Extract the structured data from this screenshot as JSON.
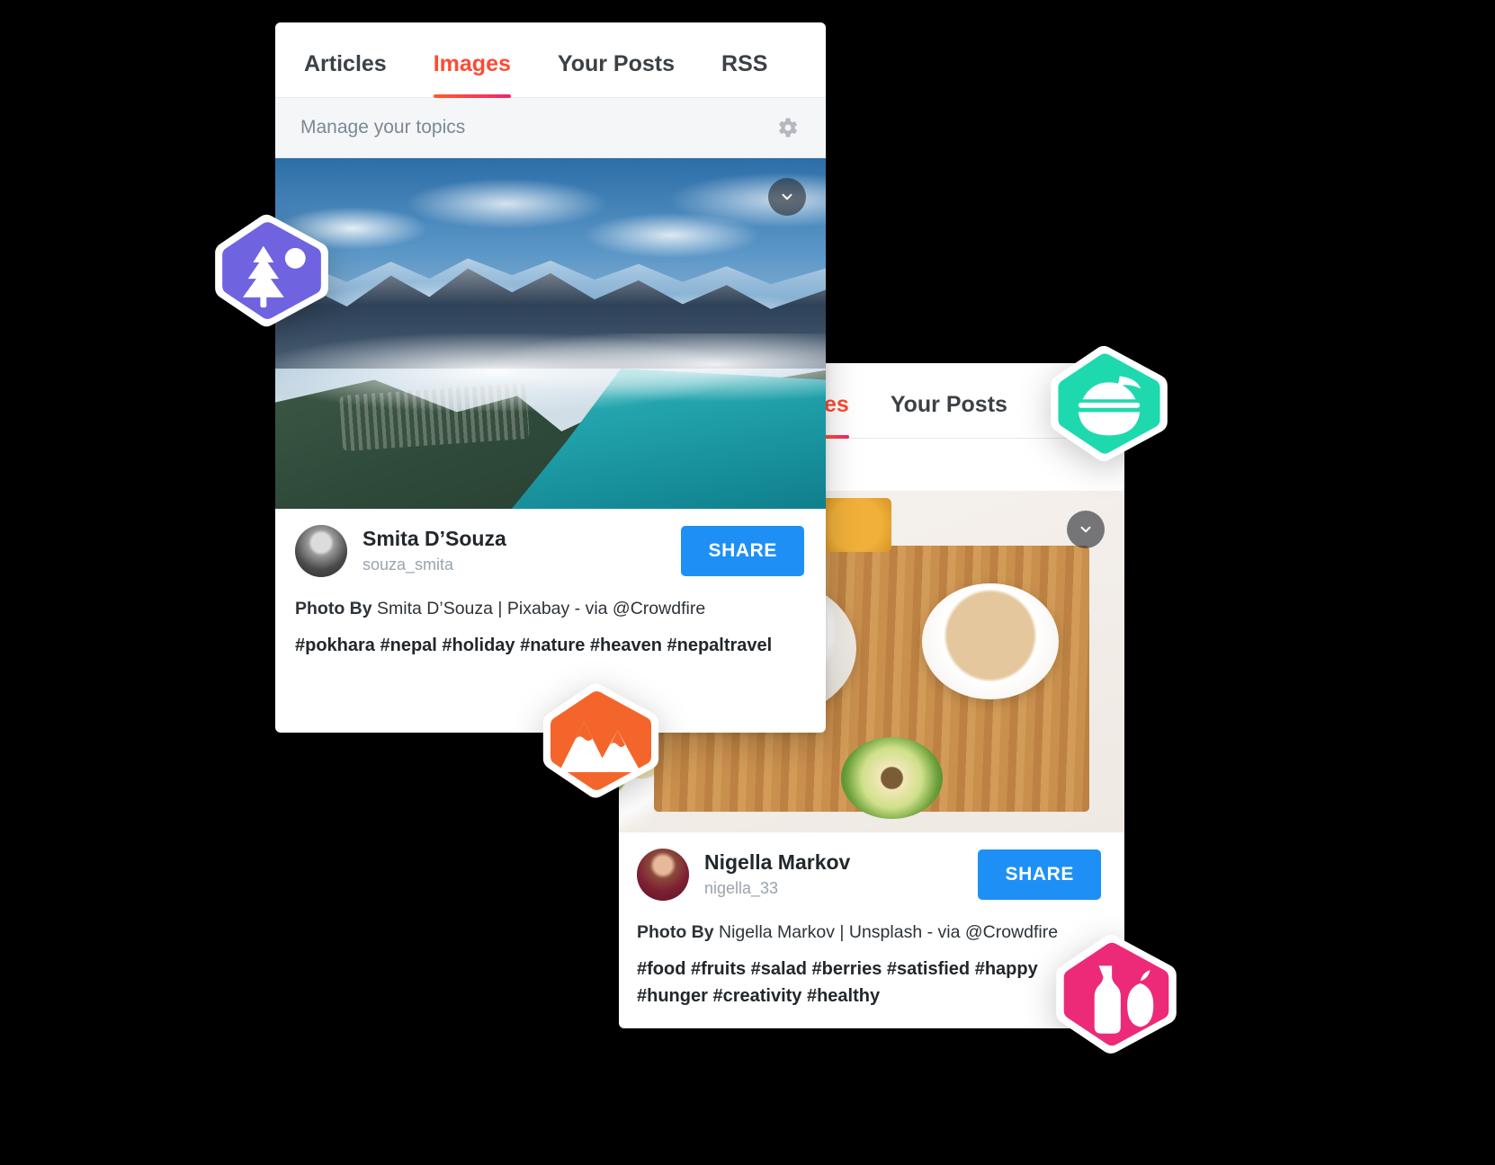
{
  "front_panel": {
    "tabs": [
      {
        "label": "Articles",
        "active": false
      },
      {
        "label": "Images",
        "active": true
      },
      {
        "label": "Your Posts",
        "active": false
      },
      {
        "label": "RSS",
        "active": false
      }
    ],
    "topic_bar": {
      "label": "Manage your topics",
      "gear_icon": "gear-icon"
    },
    "card": {
      "photo_alt": "mountain-lake-landscape",
      "chevron_icon": "chevron-down-icon",
      "user_name": "Smita D’Souza",
      "user_handle": "souza_smita",
      "share_label": "SHARE",
      "credit_prefix": "Photo By",
      "credit_text": "Smita D’Souza | Pixabay - via @Crowdfire",
      "hashtags": "#pokhara #nepal #holiday #nature #heaven #nepaltravel"
    }
  },
  "back_panel": {
    "tabs": [
      {
        "label": "es",
        "active": true
      },
      {
        "label": "Your Posts",
        "active": false
      }
    ],
    "card": {
      "photo_alt": "breakfast-bowl-flatlay",
      "chevron_icon": "chevron-down-icon",
      "user_name": "Nigella Markov",
      "user_handle": "nigella_33",
      "share_label": "SHARE",
      "credit_prefix": "Photo By",
      "credit_text": "Nigella Markov | Unsplash - via @Crowdfire",
      "hashtags": "#food #fruits #salad #berries #satisfied #happy #hunger #creativity #healthy"
    }
  },
  "badges": [
    {
      "name": "nature-badge",
      "icon": "pine-tree-icon",
      "color": "#6f63e0"
    },
    {
      "name": "food-badge",
      "icon": "salad-bowl-icon",
      "color": "#1fd9ae"
    },
    {
      "name": "travel-badge",
      "icon": "mountains-icon",
      "color": "#f4652b"
    },
    {
      "name": "drink-badge",
      "icon": "bottle-fruit-icon",
      "color": "#ec2a78"
    }
  ],
  "colors": {
    "accent_active_tab": "#ff4a32",
    "tab_underline_from": "#ff5a2d",
    "tab_underline_to": "#f0246c",
    "share_button": "#1e90f5",
    "topic_bar_bg": "#f5f6f8",
    "topic_label": "#7d8894",
    "handle_text": "#9aa3ad"
  }
}
